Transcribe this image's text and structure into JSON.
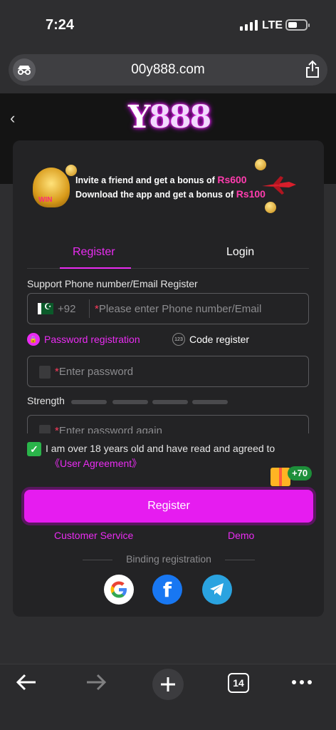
{
  "status": {
    "time": "7:24",
    "network": "LTE"
  },
  "browser": {
    "url": "00y888.com",
    "tab_count": "14"
  },
  "brand": {
    "logo_y": "Y",
    "logo_888": "888"
  },
  "banner": {
    "line1_prefix": "Invite a friend and get a bonus of ",
    "line1_amount": "Rs600",
    "line2_prefix": "Download the app and get a bonus of ",
    "line2_amount": "Rs100",
    "win_text": "WIN"
  },
  "tabs": {
    "register": "Register",
    "login": "Login"
  },
  "form": {
    "support_label": "Support Phone number/Email Register",
    "country_code": "+92",
    "phone_placeholder": "Please enter Phone number/Email",
    "password_registration": "Password registration",
    "code_register": "Code register",
    "code_icon": "123",
    "password_placeholder": "Enter password",
    "strength_label": "Strength",
    "confirm_placeholder": "Enter password again",
    "required_mark": "*",
    "agree_text": "I am over 18 years old and have read and agreed to",
    "user_agreement": "《User Agreement》",
    "bonus_badge": "+70",
    "register_button": "Register",
    "customer_service": "Customer Service",
    "demo": "Demo",
    "binding_registration": "Binding registration",
    "checked": true
  },
  "colors": {
    "accent": "#ea2cf2",
    "button": "#e61cf0",
    "check": "#2ab44a",
    "facebook": "#1877f2",
    "telegram": "#2aa3e0"
  }
}
